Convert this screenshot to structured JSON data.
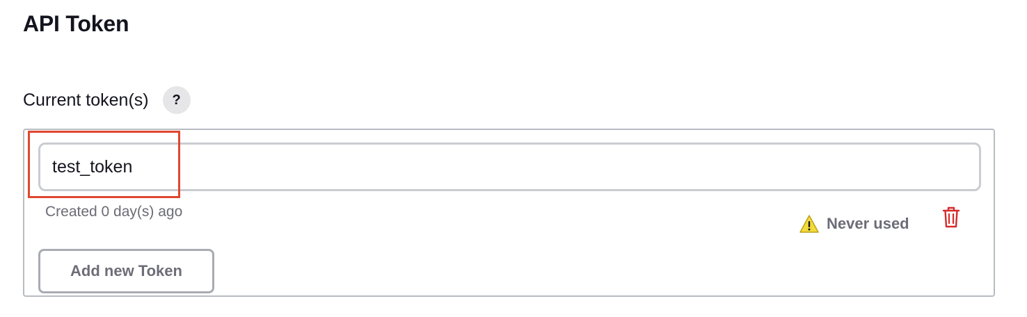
{
  "section": {
    "title": "API Token"
  },
  "tokens": {
    "label": "Current token(s)",
    "help_label": "?",
    "items": [
      {
        "name": "test_token",
        "created": "Created 0 day(s) ago",
        "usage": "Never used",
        "usage_icon": "warning-icon",
        "delete_icon": "trash-icon"
      }
    ],
    "add_button_label": "Add new Token"
  },
  "colors": {
    "highlight": "#e0462f",
    "delete": "#d62b2b",
    "warning": "#f3dc3a"
  }
}
